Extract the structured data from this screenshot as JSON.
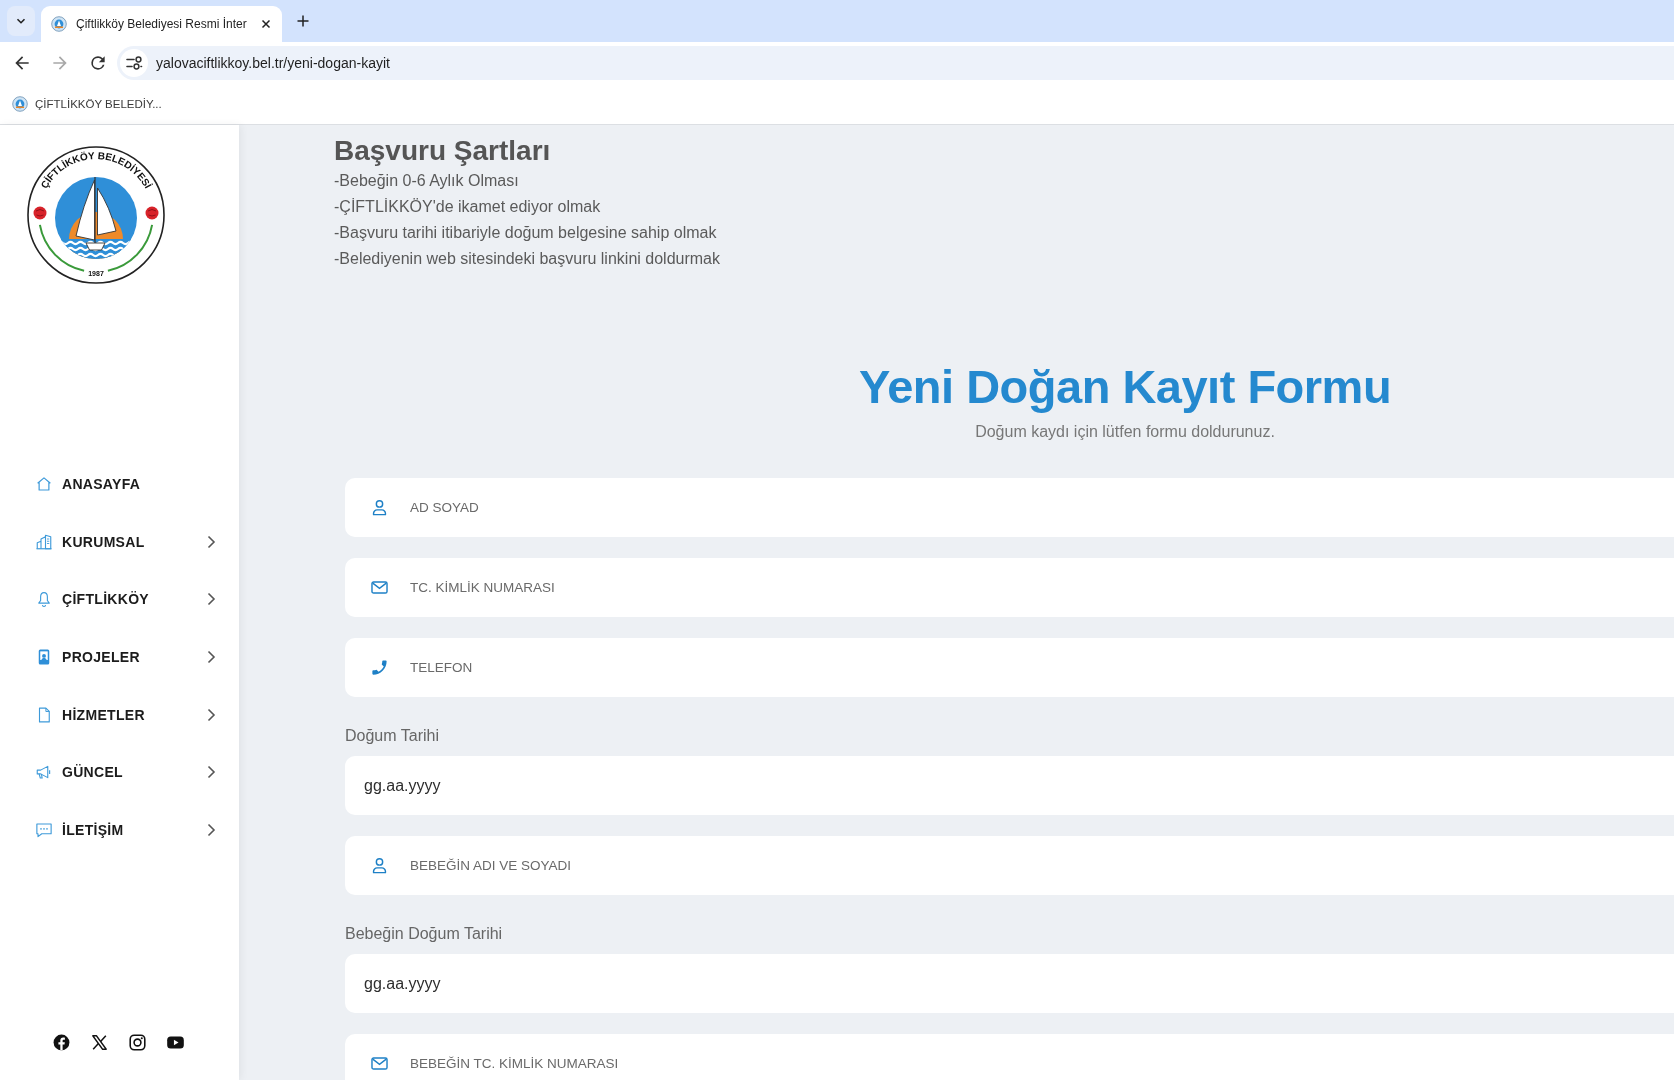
{
  "browser": {
    "tabs": [
      {
        "title": "Çiftlikköy Belediyesi Resmi İnter",
        "selected": true
      }
    ],
    "url": "yalovaciftlikkoy.bel.tr/yeni-dogan-kayit",
    "bookmark": "ÇİFTLİKKÖY BELEDİY..."
  },
  "sidebar": {
    "logo": {
      "ring_text": "ÇİFTLİKKÖY BELEDİYESİ",
      "year": "1987"
    },
    "menu": [
      {
        "label": "ANASAYFA",
        "has_submenu": false
      },
      {
        "label": "KURUMSAL",
        "has_submenu": true
      },
      {
        "label": "ÇİFTLİKKÖY",
        "has_submenu": true
      },
      {
        "label": "PROJELER",
        "has_submenu": true
      },
      {
        "label": "HİZMETLER",
        "has_submenu": true
      },
      {
        "label": "GÜNCEL",
        "has_submenu": true
      },
      {
        "label": "İLETİŞİM",
        "has_submenu": true
      }
    ]
  },
  "requirements": {
    "title": "Başvuru Şartları",
    "items": [
      "-Bebeğin 0-6 Aylık Olması",
      "-ÇİFTLİKKÖY'de ikamet ediyor olmak",
      "-Başvuru tarihi itibariyle doğum belgesine sahip olmak",
      "-Belediyenin web sitesindeki başvuru linkini doldurmak"
    ]
  },
  "form": {
    "title": "Yeni Doğan Kayıt Formu",
    "subtitle": "Doğum kaydı için lütfen formu doldurunuz.",
    "fields": [
      {
        "kind": "name",
        "placeholder": "AD SOYAD"
      },
      {
        "kind": "idnumber",
        "placeholder": "TC. KİMLİK NUMARASI"
      },
      {
        "kind": "phone",
        "placeholder": "TELEFON"
      },
      {
        "kind": "date",
        "label": "Doğum Tarihi",
        "placeholder": "gg.aa.yyyy"
      },
      {
        "kind": "name",
        "placeholder": "BEBEĞİN ADI VE SOYADI"
      },
      {
        "kind": "date",
        "label": "Bebeğin Doğum Tarihi",
        "placeholder": "gg.aa.yyyy"
      },
      {
        "kind": "idnumber",
        "placeholder": "BEBEĞİN TC. KİMLİK NUMARASI"
      }
    ]
  }
}
